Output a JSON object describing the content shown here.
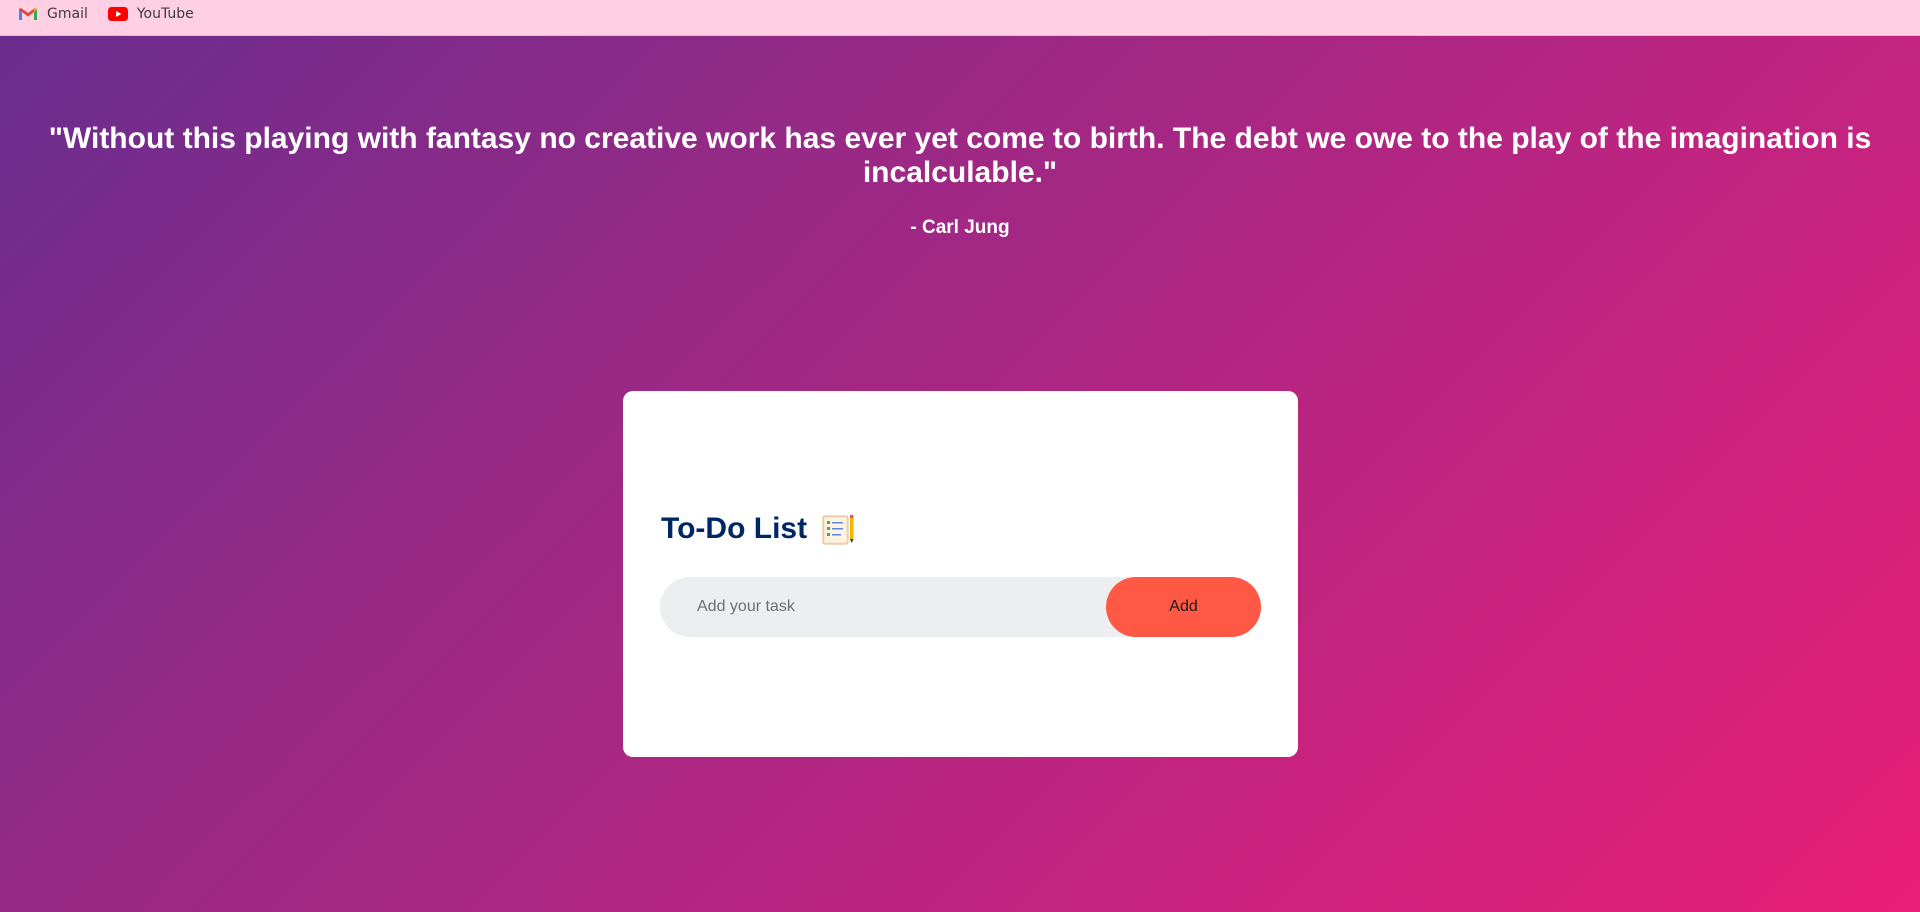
{
  "bookmarks": [
    {
      "label": "Gmail",
      "icon": "gmail-icon"
    },
    {
      "label": "YouTube",
      "icon": "youtube-icon"
    }
  ],
  "quote": {
    "text": "\"Without this playing with fantasy no creative work has ever yet come to birth. The debt we owe to the play of the imagination is incalculable.\"",
    "author": "- Carl Jung"
  },
  "todo": {
    "title": "To-Do List",
    "title_icon": "checklist-pencil-icon",
    "input_placeholder": "Add your task",
    "input_value": "",
    "add_label": "Add"
  },
  "colors": {
    "bookmarks_bar": "#ffd0e4",
    "gradient_start": "#6a2c8e",
    "gradient_end": "#e91e78",
    "title_color": "#002765",
    "add_button": "#ff5945",
    "input_bg": "#edeef0"
  }
}
